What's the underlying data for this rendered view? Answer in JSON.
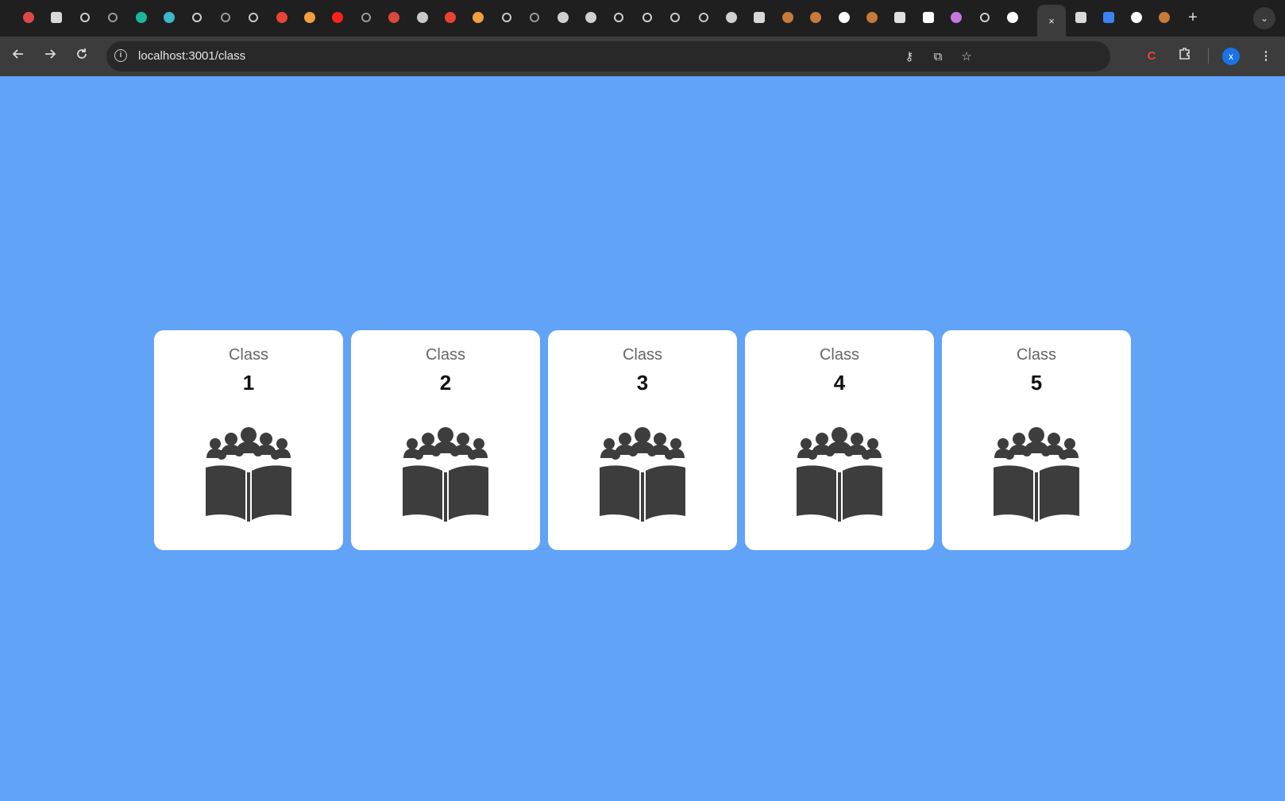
{
  "browser": {
    "url": "localhost:3001/class",
    "tab_close_glyph": "×",
    "new_tab_glyph": "+",
    "tab_search_glyph": "⌄",
    "favicons": [
      {
        "icon": "red-circle-icon",
        "color": "#e04848"
      },
      {
        "icon": "square-app-icon",
        "color": "#d8d8d8"
      },
      {
        "icon": "globe-icon",
        "color": "#cfcfcf"
      },
      {
        "icon": "ring-icon",
        "color": "#9a9a9a"
      },
      {
        "icon": "teal-circle-icon",
        "color": "#1bb59c"
      },
      {
        "icon": "react-icon",
        "color": "#3bb8c9"
      },
      {
        "icon": "globe-icon",
        "color": "#cfcfcf"
      },
      {
        "icon": "ring-icon",
        "color": "#9a9a9a"
      },
      {
        "icon": "chatgpt-icon",
        "color": "#c9c9c9"
      },
      {
        "icon": "gmail-icon",
        "color": "#ea4335"
      },
      {
        "icon": "infinity-icon",
        "color": "#f2a03c"
      },
      {
        "icon": "youtube-icon",
        "color": "#ff2020"
      },
      {
        "icon": "ring-icon",
        "color": "#9a9a9a"
      },
      {
        "icon": "red-circle-icon",
        "color": "#d9473d"
      },
      {
        "icon": "gear-app-icon",
        "color": "#c9c9c9"
      },
      {
        "icon": "gmail-icon",
        "color": "#ea4335"
      },
      {
        "icon": "infinity-icon",
        "color": "#f2a03c"
      },
      {
        "icon": "chatgpt-icon",
        "color": "#c9c9c9"
      },
      {
        "icon": "ring-icon",
        "color": "#9a9a9a"
      },
      {
        "icon": "gear-app-icon",
        "color": "#d0d0d0"
      },
      {
        "icon": "gear-app-icon",
        "color": "#d0d0d0"
      },
      {
        "icon": "arrow-circle-icon",
        "color": "#d0d0d0"
      },
      {
        "icon": "arrow-circle-icon",
        "color": "#d0d0d0"
      },
      {
        "icon": "chatgpt-icon",
        "color": "#c9c9c9"
      },
      {
        "icon": "chatgpt-icon",
        "color": "#c9c9c9"
      },
      {
        "icon": "gear-app-icon",
        "color": "#d0d0d0"
      },
      {
        "icon": "square-app-icon",
        "color": "#d8d8d8"
      },
      {
        "icon": "person-icon",
        "color": "#c77a3a"
      },
      {
        "icon": "person-icon",
        "color": "#c77a3a"
      },
      {
        "icon": "google-icon",
        "color": "#ffffff"
      },
      {
        "icon": "person-icon",
        "color": "#c77a3a"
      },
      {
        "icon": "square-app-icon",
        "color": "#e0e0e0"
      },
      {
        "icon": "medium-icon",
        "color": "#ffffff"
      },
      {
        "icon": "gem-icon",
        "color": "#c977e0"
      },
      {
        "icon": "globe-icon",
        "color": "#cfcfcf"
      },
      {
        "icon": "github-icon",
        "color": "#ffffff"
      }
    ],
    "after_active": [
      {
        "icon": "puzzle-icon",
        "color": "#dadada"
      },
      {
        "icon": "dash-icon",
        "color": "#3b82f6"
      },
      {
        "icon": "github-icon",
        "color": "#ffffff"
      },
      {
        "icon": "person-icon",
        "color": "#c77a3a"
      }
    ],
    "extensions": [
      {
        "icon": "password-key-icon",
        "glyph": "⚷"
      },
      {
        "icon": "install-app-icon",
        "glyph": "⧉"
      },
      {
        "icon": "bookmark-star-icon",
        "glyph": "☆"
      }
    ],
    "profile_initial": "x"
  },
  "classes": [
    {
      "label": "Class",
      "number": "1"
    },
    {
      "label": "Class",
      "number": "2"
    },
    {
      "label": "Class",
      "number": "3"
    },
    {
      "label": "Class",
      "number": "4"
    },
    {
      "label": "Class",
      "number": "5"
    }
  ]
}
